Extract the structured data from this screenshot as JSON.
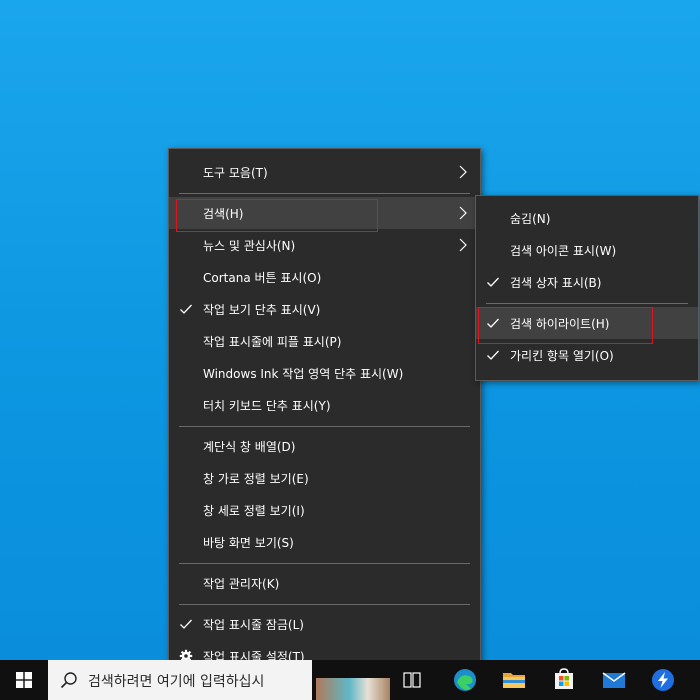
{
  "main_menu": {
    "items": [
      {
        "label": "도구 모음(T)"
      },
      {
        "label": "검색(H)"
      },
      {
        "label": "뉴스 및 관심사(N)"
      },
      {
        "label": "Cortana 버튼 표시(O)"
      },
      {
        "label": "작업 보기 단추 표시(V)"
      },
      {
        "label": "작업 표시줄에 피플 표시(P)"
      },
      {
        "label": "Windows Ink 작업 영역 단추 표시(W)"
      },
      {
        "label": "터치 키보드 단추 표시(Y)"
      },
      {
        "label": "계단식 창 배열(D)"
      },
      {
        "label": "창 가로 정렬 보기(E)"
      },
      {
        "label": "창 세로 정렬 보기(I)"
      },
      {
        "label": "바탕 화면 보기(S)"
      },
      {
        "label": "작업 관리자(K)"
      },
      {
        "label": "작업 표시줄 잠금(L)"
      },
      {
        "label": "작업 표시줄 설정(T)"
      }
    ]
  },
  "sub_menu": {
    "items": [
      {
        "label": "숨김(N)"
      },
      {
        "label": "검색 아이콘 표시(W)"
      },
      {
        "label": "검색 상자 표시(B)"
      },
      {
        "label": "검색 하이라이트(H)"
      },
      {
        "label": "가리킨 항목 열기(O)"
      }
    ]
  },
  "taskbar": {
    "search_placeholder": "검색하려면 여기에 입력하십시"
  },
  "colors": {
    "desktop": "#0c95e0",
    "menu_bg": "#2b2b2b",
    "highlight": "#414141",
    "annotation": "#e0141e"
  }
}
